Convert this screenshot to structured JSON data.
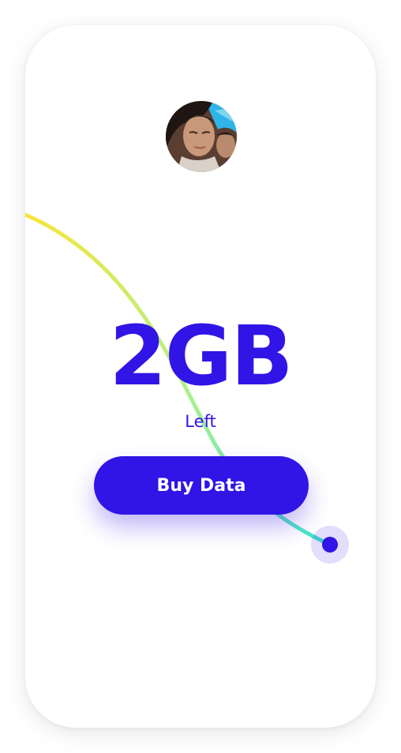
{
  "data_balance": {
    "amount": "2GB",
    "label": "Left",
    "remaining_fraction": 0.36
  },
  "actions": {
    "buy_label": "Buy Data"
  },
  "profile": {
    "avatar_icon": "user-photo-avatar"
  },
  "colors": {
    "accent": "#3114e6",
    "arc_start": "#f7e53a",
    "arc_mid": "#b4f089",
    "arc_end": "#3ee6cf",
    "card_background": "#ffffff"
  }
}
